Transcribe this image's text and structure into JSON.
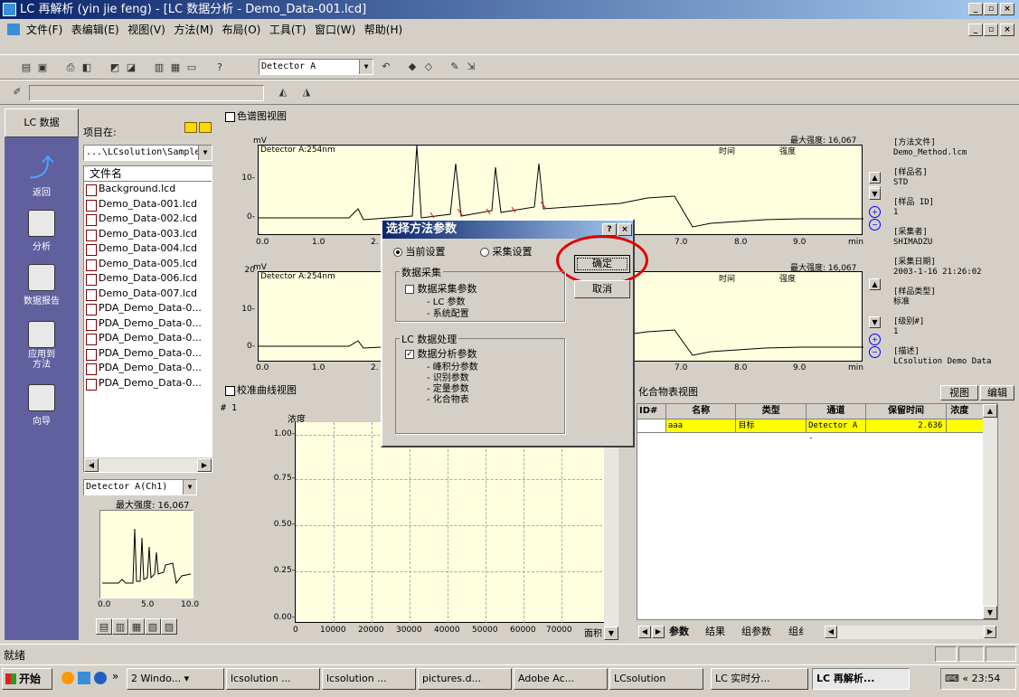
{
  "window": {
    "title": "LC 再解析 (yin jie feng) - [LC 数据分析 - Demo_Data-001.lcd]"
  },
  "menu": [
    "文件(F)",
    "表编辑(E)",
    "视图(V)",
    "方法(M)",
    "布局(O)",
    "工具(T)",
    "窗口(W)",
    "帮助(H)"
  ],
  "toolbar": {
    "detector_combo": "Detector A"
  },
  "sidebar": {
    "header": "LC 数据",
    "items": [
      {
        "label": "返回",
        "icon": "return-arrow-icon"
      },
      {
        "label": "分析",
        "icon": "analysis-icon"
      },
      {
        "label": "数据报告",
        "icon": "data-report-icon"
      },
      {
        "label": "应用到\n方法",
        "icon": "apply-to-method-icon"
      },
      {
        "label": "向导",
        "icon": "wizard-icon"
      }
    ]
  },
  "filepanel": {
    "project_label": "项目在:",
    "path": "...\\LCsolution\\Sample",
    "column_header": "文件名",
    "files": [
      "Background.lcd",
      "Demo_Data-001.lcd",
      "Demo_Data-002.lcd",
      "Demo_Data-003.lcd",
      "Demo_Data-004.lcd",
      "Demo_Data-005.lcd",
      "Demo_Data-006.lcd",
      "Demo_Data-007.lcd",
      "PDA_Demo_Data-0...",
      "PDA_Demo_Data-0...",
      "PDA_Demo_Data-0...",
      "PDA_Demo_Data-0...",
      "PDA_Demo_Data-0...",
      "PDA_Demo_Data-0..."
    ],
    "detector_select": "Detector A(Ch1)",
    "max_intensity": "最大强度: 16,067",
    "thumb_xticks": [
      "0.0",
      "5.0",
      "10.0"
    ]
  },
  "chromatogram": {
    "panel_title": "色谱图视图",
    "unit": "mV",
    "trace_label": "Detector A:254nm",
    "max_intensity": "最大强度: 16,067",
    "col_time": "时间",
    "col_intensity": "强度",
    "top_yticks": [
      "10-",
      "0-"
    ],
    "bottom_yticks": [
      "20",
      "10-",
      "0-"
    ],
    "xticks": [
      "0.0",
      "1.0",
      "2.",
      "7.0",
      "8.0",
      "9.0",
      "min"
    ]
  },
  "sample_info": {
    "method_file_label": "[方法文件]",
    "method_file": "Demo_Method.lcm",
    "sample_name_label": "[样品名]",
    "sample_name": "STD",
    "sample_id_label": "[样品 ID]",
    "sample_id": "1",
    "collector_label": "[采集者]",
    "collector": "SHIMADZU",
    "date_label": "[采集日期]",
    "date": "2003-1-16 21:26:02",
    "sample_type_label": "[样品类型]",
    "sample_type": "标准",
    "level_label": "[级别#]",
    "level": "1",
    "desc_label": "[描述]",
    "desc": "LCsolution Demo Data"
  },
  "calibration": {
    "panel_title": "校准曲线视图",
    "id": "# 1",
    "ylabel": "浓度",
    "xlabel": "面积",
    "yticks": [
      "1.00-",
      "0.75-",
      "0.50-",
      "0.25-",
      "0.00-"
    ],
    "xticks": [
      "0",
      "10000",
      "20000",
      "30000",
      "40000",
      "50000",
      "60000",
      "70000"
    ]
  },
  "compound": {
    "panel_title": "化合物表视图",
    "view_button": "视图",
    "edit_button": "编辑",
    "headers": [
      "ID#",
      "名称",
      "类型",
      "通道",
      "保留时间",
      "浓度"
    ],
    "rows": [
      [
        "",
        "aaa",
        "目标",
        "Detector A -",
        "2.636",
        ""
      ]
    ],
    "tabs": [
      "参数",
      "结果",
      "组参数",
      "组纟"
    ]
  },
  "dialog": {
    "title": "选择方法参数",
    "radio_current": "当前设置",
    "radio_collect": "采集设置",
    "ok": "确定",
    "cancel": "取消",
    "group1_title": "数据采集",
    "group1_check": "数据采集参数",
    "group1_items": [
      "- LC 参数",
      "- 系统配置"
    ],
    "group2_title": "LC 数据处理",
    "group2_check": "数据分析参数",
    "group2_items": [
      "- 峰积分参数",
      "- 识别参数",
      "- 定量参数",
      "- 化合物表"
    ]
  },
  "status": {
    "text": "就绪"
  },
  "taskbar": {
    "start": "开始",
    "items": [
      "2 Windo...",
      "lcsolution ...",
      "lcsolution ...",
      "pictures.d...",
      "Adobe Ac...",
      "LCsolution",
      "LC 实时分...",
      "LC 再解析..."
    ],
    "time": "23:54"
  }
}
